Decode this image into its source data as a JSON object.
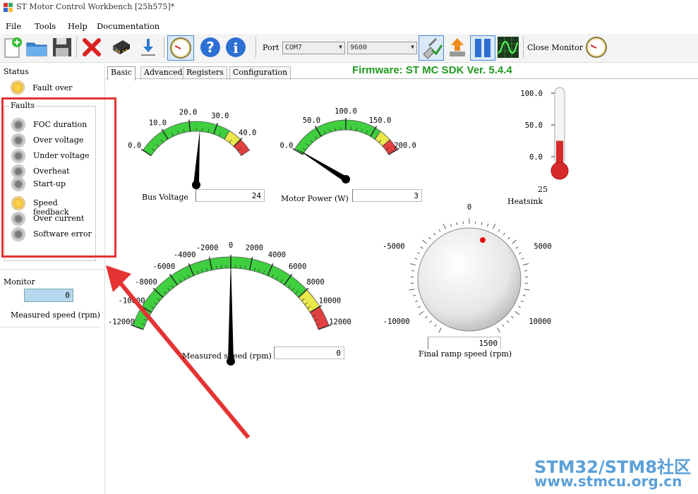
{
  "window": {
    "title": "ST Motor Control Workbench [25h575]*"
  },
  "menu": [
    "File",
    "Tools",
    "Help",
    "Documentation"
  ],
  "toolbar": {
    "port_label": "Port",
    "port_value": "COM7",
    "baud_value": "9600",
    "close_monitor_label": "Close Monitor"
  },
  "status": {
    "group_label": "Status",
    "item": "Fault over"
  },
  "faults": {
    "group_label": "Faults",
    "items": [
      {
        "label": "FOC duration",
        "state": "off"
      },
      {
        "label": "Over voltage",
        "state": "off"
      },
      {
        "label": "Under voltage",
        "state": "off"
      },
      {
        "label": "Overheat",
        "state": "off"
      },
      {
        "label": "Start-up",
        "state": "off"
      },
      {
        "label": "Speed feedback",
        "state": "on"
      },
      {
        "label": "Over current",
        "state": "off"
      },
      {
        "label": "Software error",
        "state": "off"
      }
    ]
  },
  "monitor": {
    "group_label": "Monitor",
    "value": "0",
    "caption": "Measured speed (rpm)"
  },
  "tabs": [
    "Basic",
    "Advanced",
    "Registers",
    "Configuration"
  ],
  "firmware": "Firmware: ST MC SDK Ver. 5.4.4",
  "gauges": {
    "bus_voltage": {
      "label": "Bus Voltage",
      "value": "24",
      "ticks": [
        "0.0",
        "10.0",
        "20.0",
        "30.0",
        "40.0"
      ],
      "min": 0,
      "max": 45,
      "reading": 24
    },
    "motor_power": {
      "label": "Motor Power (W)",
      "value": "3",
      "ticks": [
        "0.0",
        "50.0",
        "100.0",
        "150.0",
        "200.0"
      ],
      "min": 0,
      "max": 200,
      "reading": 3
    },
    "speed": {
      "label": "Measured speed (rpm)",
      "value": "0",
      "ticks": [
        "-12000",
        "-10000",
        "-8000",
        "-6000",
        "-4000",
        "-2000",
        "0",
        "2000",
        "4000",
        "6000",
        "8000",
        "10000",
        "12000"
      ],
      "min": -12000,
      "max": 12000,
      "reading": 0
    },
    "heatsink": {
      "label": "Heatsink",
      "value": "25",
      "ticks": [
        "100.0",
        "50.0",
        "0.0"
      ],
      "min": -25,
      "max": 100,
      "reading": 25
    },
    "ramp_knob": {
      "label": "Final ramp speed (rpm)",
      "value": "1500",
      "ticks": [
        "0",
        "5000",
        "10000",
        "-5000",
        "-10000"
      ],
      "min": -12000,
      "max": 12000,
      "reading": 1500
    }
  },
  "watermark": {
    "line1": "STM32/STM8社区",
    "line2": "www.stmcu.org.cn"
  },
  "colors": {
    "accent_red": "#e53333",
    "firmware_green": "#1f9a1f",
    "gauge_green": "#3fcf3f",
    "gauge_yellow": "#e8e84a",
    "gauge_red": "#e04040"
  }
}
